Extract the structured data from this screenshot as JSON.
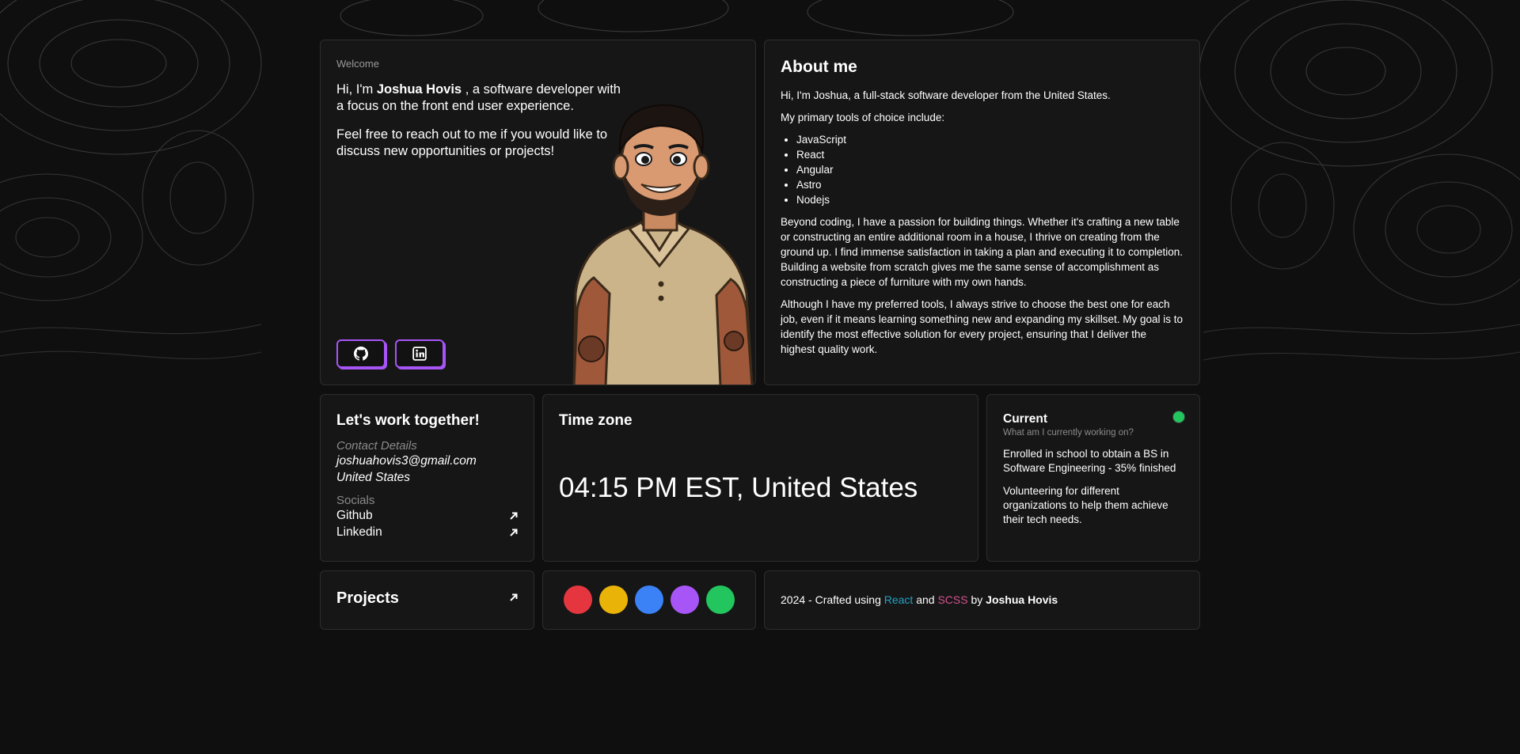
{
  "welcome": {
    "label": "Welcome",
    "greeting_prefix": "Hi, I'm ",
    "name": "Joshua Hovis",
    "greeting_suffix": " , a software developer with a focus on the front end user experience.",
    "reach_out": "Feel free to reach out to me if you would like to discuss new opportunities or projects!",
    "github_icon": "github-icon",
    "linkedin_icon": "linkedin-icon"
  },
  "about": {
    "title": "About me",
    "intro": "Hi, I'm Joshua, a full-stack software developer from the United States.",
    "tools_intro": "My primary tools of choice include:",
    "tools": [
      "JavaScript",
      "React",
      "Angular",
      "Astro",
      "Nodejs"
    ],
    "beyond": "Beyond coding, I have a passion for building things. Whether it's crafting a new table or constructing an entire additional room in a house, I thrive on creating from the ground up. I find immense satisfaction in taking a plan and executing it to completion. Building a website from scratch gives me the same sense of accomplishment as constructing a piece of furniture with my own hands.",
    "although": "Although I have my preferred tools, I always strive to choose the best one for each job, even if it means learning something new and expanding my skillset. My goal is to identify the most effective solution for every project, ensuring that I deliver the highest quality work."
  },
  "contact": {
    "title": "Let's work together!",
    "details_label": "Contact Details",
    "email": "joshuahovis3@gmail.com",
    "location": "United States",
    "socials_label": "Socials",
    "socials": [
      "Github",
      "Linkedin"
    ]
  },
  "timezone": {
    "title": "Time zone",
    "time": "04:15 PM EST, United States"
  },
  "current": {
    "title": "Current",
    "subtitle": "What am I currently working on?",
    "item1": "Enrolled in school to obtain a BS in Software Engineering - 35% finished",
    "item2": "Volunteering for different organizations to help them achieve their tech needs.",
    "status_color": "#22c55e"
  },
  "projects": {
    "title": "Projects"
  },
  "swatches": [
    "#e5363f",
    "#eab308",
    "#3b82f6",
    "#a855f7",
    "#22c55e"
  ],
  "footer": {
    "prefix": "2024 - Crafted using ",
    "react": "React",
    "and": " and ",
    "scss": "SCSS",
    "by": " by ",
    "author": "Joshua Hovis"
  }
}
